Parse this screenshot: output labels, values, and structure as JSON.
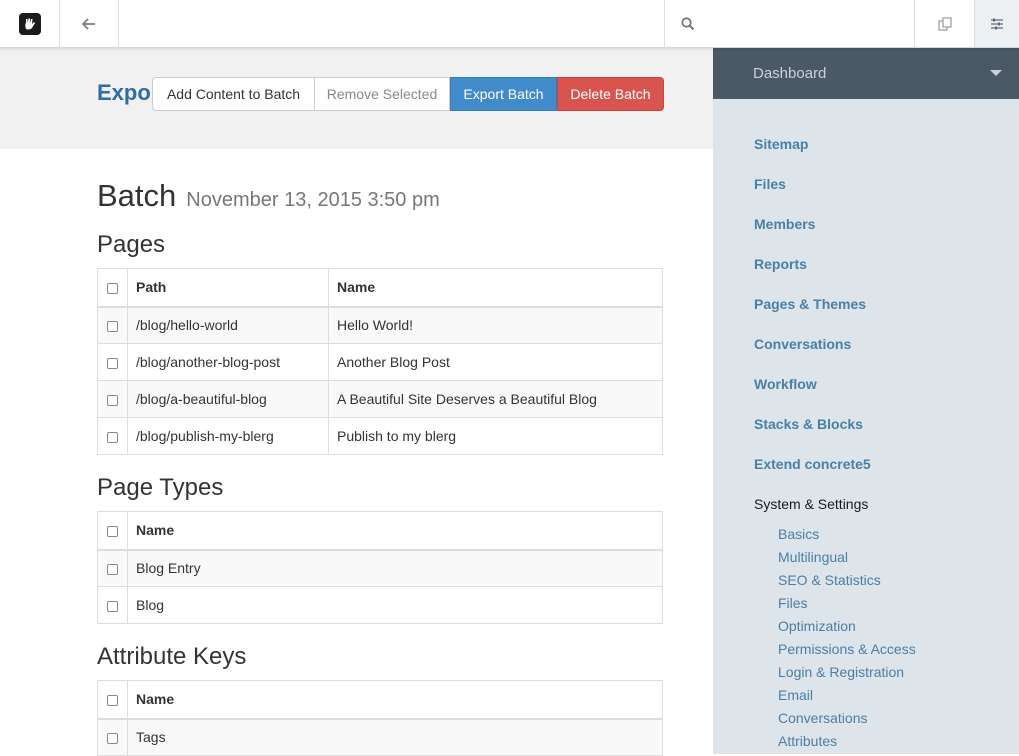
{
  "toolbar": {
    "search_placeholder": "",
    "colors": {
      "settings_bg": "#eef1f4"
    }
  },
  "header": {
    "title": "Expo",
    "buttons": {
      "add": "Add Content to Batch",
      "remove": "Remove Selected",
      "export": "Export Batch",
      "delete": "Delete Batch"
    }
  },
  "batch": {
    "label": "Batch",
    "date": "November 13, 2015 3:50 pm"
  },
  "pages": {
    "title": "Pages",
    "columns": [
      "Path",
      "Name"
    ],
    "rows": [
      {
        "path": "/blog/hello-world",
        "name": "Hello World!"
      },
      {
        "path": "/blog/another-blog-post",
        "name": "Another Blog Post"
      },
      {
        "path": "/blog/a-beautiful-blog",
        "name": "A Beautiful Site Deserves a Beautiful Blog"
      },
      {
        "path": "/blog/publish-my-blerg",
        "name": "Publish to my blerg"
      }
    ]
  },
  "page_types": {
    "title": "Page Types",
    "column": "Name",
    "rows": [
      "Blog Entry",
      "Blog"
    ]
  },
  "attribute_keys": {
    "title": "Attribute Keys",
    "column": "Name",
    "rows": [
      "Tags"
    ]
  },
  "panel": {
    "header": "Dashboard",
    "items": [
      "Sitemap",
      "Files",
      "Members",
      "Reports",
      "Pages & Themes",
      "Conversations",
      "Workflow",
      "Stacks & Blocks",
      "Extend concrete5",
      "System & Settings"
    ],
    "sub_items": [
      "Basics",
      "Multilingual",
      "SEO & Statistics",
      "Files",
      "Optimization",
      "Permissions & Access",
      "Login & Registration",
      "Email",
      "Conversations",
      "Attributes"
    ]
  }
}
